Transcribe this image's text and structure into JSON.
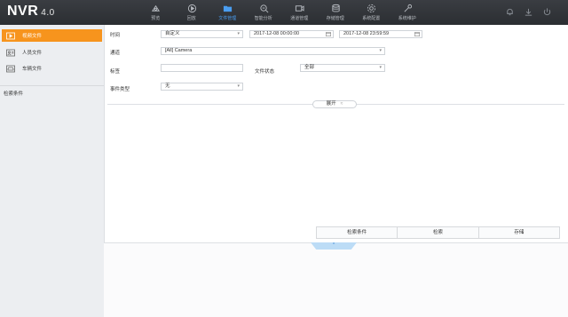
{
  "app": {
    "logo": "NVR",
    "version": "4.0"
  },
  "nav": [
    {
      "label": "预览",
      "icon": "preview-icon",
      "active": false
    },
    {
      "label": "回放",
      "icon": "playback-icon",
      "active": false
    },
    {
      "label": "文件管理",
      "icon": "folder-icon",
      "active": true
    },
    {
      "label": "智能分析",
      "icon": "smart-analysis-icon",
      "active": false
    },
    {
      "label": "通道管理",
      "icon": "camera-icon",
      "active": false
    },
    {
      "label": "存储管理",
      "icon": "storage-icon",
      "active": false
    },
    {
      "label": "系统配置",
      "icon": "gear-icon",
      "active": false
    },
    {
      "label": "系统维护",
      "icon": "wrench-icon",
      "active": false
    }
  ],
  "top_right_icons": [
    "bell-icon",
    "download-icon",
    "power-icon"
  ],
  "sidebar": {
    "items": [
      {
        "label": "视频文件",
        "icon": "video-file-icon",
        "active": true
      },
      {
        "label": "人员文件",
        "icon": "person-file-icon",
        "active": false
      },
      {
        "label": "车辆文件",
        "icon": "vehicle-file-icon",
        "active": false
      }
    ],
    "section_title": "检索条件"
  },
  "form": {
    "time_label": "时间",
    "time_mode": "自定义",
    "start_time": "2017-12-08 00:00:00",
    "end_time": "2017-12-08 23:59:59",
    "channel_label": "通道",
    "channel_value": "[All] Camera",
    "tag_label": "标签",
    "tag_value": "",
    "file_status_label": "文件状态",
    "file_status_value": "全部",
    "event_type_label": "事件类型",
    "event_type_value": "无",
    "expand_label": "展开"
  },
  "table": {
    "headers": [
      "检索条件",
      "检索",
      "存储"
    ]
  },
  "bottom_tab": {
    "label": "^"
  }
}
